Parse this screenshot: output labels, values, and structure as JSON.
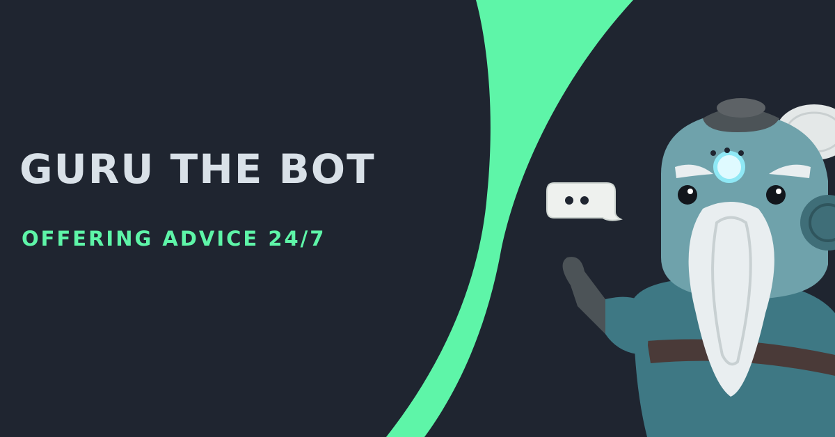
{
  "banner": {
    "title": "GURU THE BOT",
    "tagline": "OFFERING ADVICE 24/7"
  },
  "colors": {
    "background": "#1f2530",
    "accent": "#5ef5a8",
    "title_text": "#d9e1e8",
    "robot_body": "#4f8a96",
    "robot_beard": "#e9eef0"
  },
  "icons": {
    "speech": "speech-bubble-icon"
  }
}
